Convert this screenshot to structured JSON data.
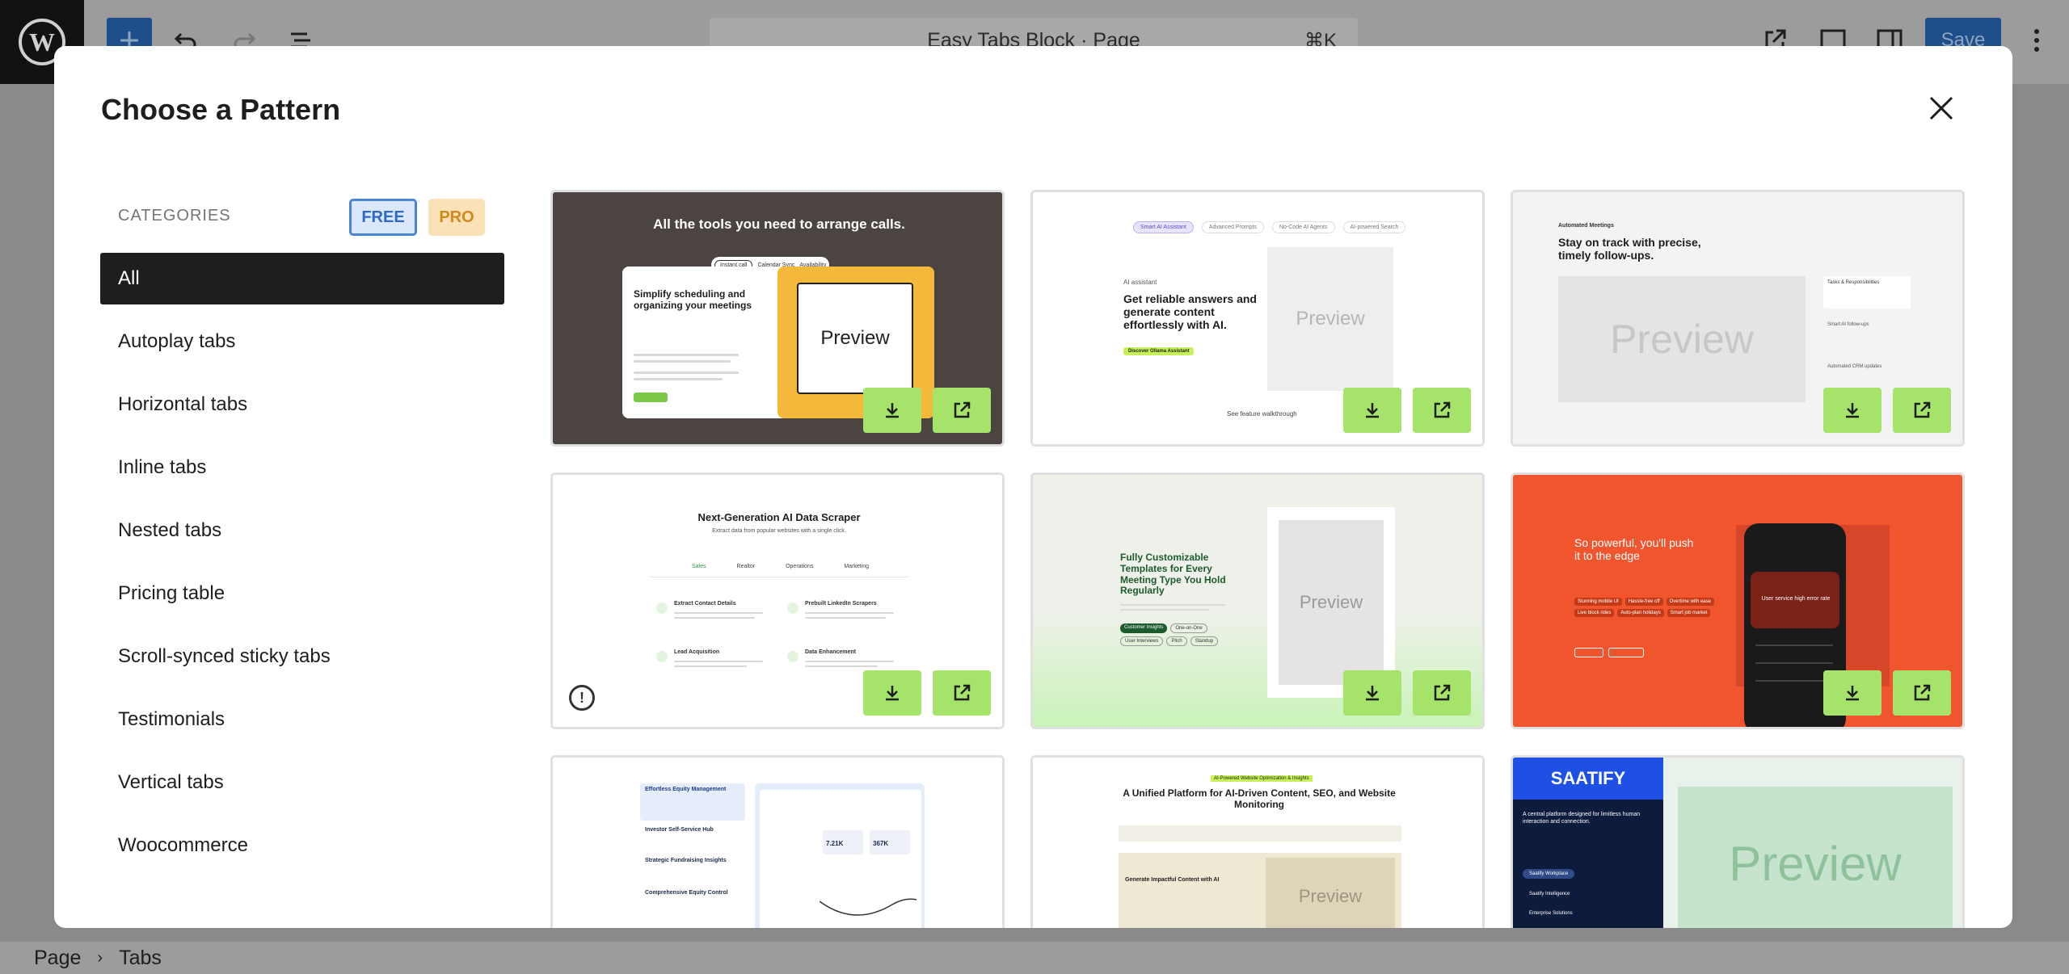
{
  "editor": {
    "document_title": "Easy Tabs Block · Page",
    "shortcut": "⌘K",
    "save_label": "Save"
  },
  "breadcrumb": [
    "Page",
    "Tabs"
  ],
  "modal": {
    "title": "Choose a Pattern",
    "categories_label": "CATEGORIES",
    "free_label": "FREE",
    "pro_label": "PRO",
    "categories": [
      "All",
      "Autoplay tabs",
      "Horizontal tabs",
      "Inline tabs",
      "Nested tabs",
      "Pricing table",
      "Scroll-synced sticky tabs",
      "Testimonials",
      "Vertical tabs",
      "Woocommerce"
    ],
    "active_category": "All"
  },
  "patterns": {
    "p1": {
      "heading": "All the tools you need to arrange calls.",
      "tabs": [
        "Instant call",
        "Calendar Sync",
        "Availability"
      ],
      "subheading": "Simplify scheduling and organizing your meetings",
      "preview": "Preview"
    },
    "p2": {
      "tabs": [
        "Smart AI Assistant",
        "Advanced Prompts",
        "No-Code AI Agents",
        "AI-powered Search"
      ],
      "eyebrow": "AI assistant",
      "heading": "Get reliable answers and generate content effortlessly with AI.",
      "cta": "Discover Ollama Assistant",
      "link": "See feature walkthrough",
      "preview": "Preview"
    },
    "p3": {
      "eyebrow": "Automated Meetings",
      "heading": "Stay on track with precise, timely follow-ups.",
      "items": [
        "Tasks & Responsibilities",
        "Smart AI follow-ups",
        "Automated CRM updates"
      ],
      "preview": "Preview"
    },
    "p4": {
      "heading": "Next-Generation AI Data Scraper",
      "subheading": "Extract data from popular websites with a single click.",
      "tabs": [
        "Sales",
        "Realtor",
        "Operations",
        "Marketing"
      ],
      "features": [
        "Extract Contact Details",
        "Prebuilt LinkedIn Scrapers",
        "Lead Acquisition",
        "Data Enhancement"
      ]
    },
    "p5": {
      "heading": "Fully Customizable Templates for Every Meeting Type You Hold Regularly",
      "tags": [
        "Customer Insights",
        "One-on-One",
        "User Interviews",
        "Pitch",
        "Standup"
      ],
      "preview": "Preview"
    },
    "p6": {
      "heading": "So powerful, you'll push it to the edge",
      "chips": [
        "Stunning mobile UI",
        "Hassle-free off",
        "Overtime with ease",
        "Live block rides",
        "Auto-plan holidays",
        "Smart job market"
      ],
      "phone_text": "User service high error rate"
    },
    "p7": {
      "items": [
        "Effortless Equity Management",
        "Investor Self-Service Hub",
        "Strategic Fundraising Insights",
        "Comprehensive Equity Control"
      ],
      "stat1": "7.21K",
      "stat2": "367K"
    },
    "p8": {
      "badge": "AI-Powered Website Optimization & Insights",
      "heading": "A Unified Platform for AI-Driven Content, SEO, and Website Monitoring",
      "subheading": "Generate Impactful Content with AI",
      "preview": "Preview"
    },
    "p9": {
      "brand": "SAATIFY",
      "tagline": "A central platform designed for limitless human interaction and connection.",
      "menu": [
        "Saatify Workplace",
        "Saatify Intelligence",
        "Enterprise Solutions"
      ],
      "preview": "Preview"
    }
  },
  "colors": {
    "accent": "#a6e36a",
    "dark": "#1e1e1e",
    "wp_blue": "#1f4f8a"
  }
}
